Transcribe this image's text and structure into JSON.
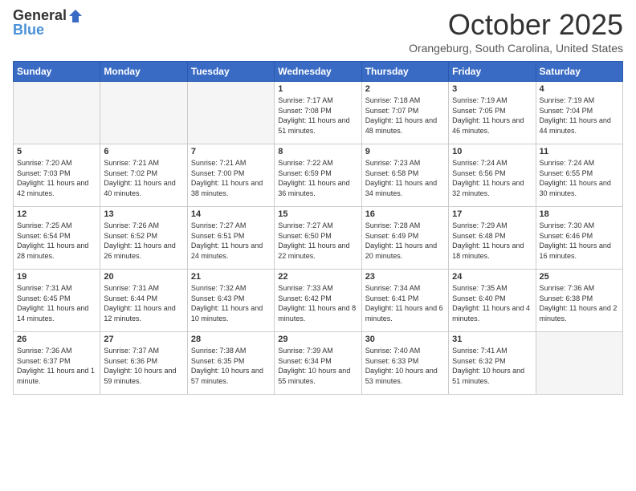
{
  "header": {
    "logo_general": "General",
    "logo_blue": "Blue",
    "month": "October 2025",
    "location": "Orangeburg, South Carolina, United States"
  },
  "weekdays": [
    "Sunday",
    "Monday",
    "Tuesday",
    "Wednesday",
    "Thursday",
    "Friday",
    "Saturday"
  ],
  "weeks": [
    [
      {
        "day": "",
        "sunrise": "",
        "sunset": "",
        "daylight": "",
        "empty": true
      },
      {
        "day": "",
        "sunrise": "",
        "sunset": "",
        "daylight": "",
        "empty": true
      },
      {
        "day": "",
        "sunrise": "",
        "sunset": "",
        "daylight": "",
        "empty": true
      },
      {
        "day": "1",
        "sunrise": "Sunrise: 7:17 AM",
        "sunset": "Sunset: 7:08 PM",
        "daylight": "Daylight: 11 hours and 51 minutes."
      },
      {
        "day": "2",
        "sunrise": "Sunrise: 7:18 AM",
        "sunset": "Sunset: 7:07 PM",
        "daylight": "Daylight: 11 hours and 48 minutes."
      },
      {
        "day": "3",
        "sunrise": "Sunrise: 7:19 AM",
        "sunset": "Sunset: 7:05 PM",
        "daylight": "Daylight: 11 hours and 46 minutes."
      },
      {
        "day": "4",
        "sunrise": "Sunrise: 7:19 AM",
        "sunset": "Sunset: 7:04 PM",
        "daylight": "Daylight: 11 hours and 44 minutes."
      }
    ],
    [
      {
        "day": "5",
        "sunrise": "Sunrise: 7:20 AM",
        "sunset": "Sunset: 7:03 PM",
        "daylight": "Daylight: 11 hours and 42 minutes."
      },
      {
        "day": "6",
        "sunrise": "Sunrise: 7:21 AM",
        "sunset": "Sunset: 7:02 PM",
        "daylight": "Daylight: 11 hours and 40 minutes."
      },
      {
        "day": "7",
        "sunrise": "Sunrise: 7:21 AM",
        "sunset": "Sunset: 7:00 PM",
        "daylight": "Daylight: 11 hours and 38 minutes."
      },
      {
        "day": "8",
        "sunrise": "Sunrise: 7:22 AM",
        "sunset": "Sunset: 6:59 PM",
        "daylight": "Daylight: 11 hours and 36 minutes."
      },
      {
        "day": "9",
        "sunrise": "Sunrise: 7:23 AM",
        "sunset": "Sunset: 6:58 PM",
        "daylight": "Daylight: 11 hours and 34 minutes."
      },
      {
        "day": "10",
        "sunrise": "Sunrise: 7:24 AM",
        "sunset": "Sunset: 6:56 PM",
        "daylight": "Daylight: 11 hours and 32 minutes."
      },
      {
        "day": "11",
        "sunrise": "Sunrise: 7:24 AM",
        "sunset": "Sunset: 6:55 PM",
        "daylight": "Daylight: 11 hours and 30 minutes."
      }
    ],
    [
      {
        "day": "12",
        "sunrise": "Sunrise: 7:25 AM",
        "sunset": "Sunset: 6:54 PM",
        "daylight": "Daylight: 11 hours and 28 minutes."
      },
      {
        "day": "13",
        "sunrise": "Sunrise: 7:26 AM",
        "sunset": "Sunset: 6:52 PM",
        "daylight": "Daylight: 11 hours and 26 minutes."
      },
      {
        "day": "14",
        "sunrise": "Sunrise: 7:27 AM",
        "sunset": "Sunset: 6:51 PM",
        "daylight": "Daylight: 11 hours and 24 minutes."
      },
      {
        "day": "15",
        "sunrise": "Sunrise: 7:27 AM",
        "sunset": "Sunset: 6:50 PM",
        "daylight": "Daylight: 11 hours and 22 minutes."
      },
      {
        "day": "16",
        "sunrise": "Sunrise: 7:28 AM",
        "sunset": "Sunset: 6:49 PM",
        "daylight": "Daylight: 11 hours and 20 minutes."
      },
      {
        "day": "17",
        "sunrise": "Sunrise: 7:29 AM",
        "sunset": "Sunset: 6:48 PM",
        "daylight": "Daylight: 11 hours and 18 minutes."
      },
      {
        "day": "18",
        "sunrise": "Sunrise: 7:30 AM",
        "sunset": "Sunset: 6:46 PM",
        "daylight": "Daylight: 11 hours and 16 minutes."
      }
    ],
    [
      {
        "day": "19",
        "sunrise": "Sunrise: 7:31 AM",
        "sunset": "Sunset: 6:45 PM",
        "daylight": "Daylight: 11 hours and 14 minutes."
      },
      {
        "day": "20",
        "sunrise": "Sunrise: 7:31 AM",
        "sunset": "Sunset: 6:44 PM",
        "daylight": "Daylight: 11 hours and 12 minutes."
      },
      {
        "day": "21",
        "sunrise": "Sunrise: 7:32 AM",
        "sunset": "Sunset: 6:43 PM",
        "daylight": "Daylight: 11 hours and 10 minutes."
      },
      {
        "day": "22",
        "sunrise": "Sunrise: 7:33 AM",
        "sunset": "Sunset: 6:42 PM",
        "daylight": "Daylight: 11 hours and 8 minutes."
      },
      {
        "day": "23",
        "sunrise": "Sunrise: 7:34 AM",
        "sunset": "Sunset: 6:41 PM",
        "daylight": "Daylight: 11 hours and 6 minutes."
      },
      {
        "day": "24",
        "sunrise": "Sunrise: 7:35 AM",
        "sunset": "Sunset: 6:40 PM",
        "daylight": "Daylight: 11 hours and 4 minutes."
      },
      {
        "day": "25",
        "sunrise": "Sunrise: 7:36 AM",
        "sunset": "Sunset: 6:38 PM",
        "daylight": "Daylight: 11 hours and 2 minutes."
      }
    ],
    [
      {
        "day": "26",
        "sunrise": "Sunrise: 7:36 AM",
        "sunset": "Sunset: 6:37 PM",
        "daylight": "Daylight: 11 hours and 1 minute."
      },
      {
        "day": "27",
        "sunrise": "Sunrise: 7:37 AM",
        "sunset": "Sunset: 6:36 PM",
        "daylight": "Daylight: 10 hours and 59 minutes."
      },
      {
        "day": "28",
        "sunrise": "Sunrise: 7:38 AM",
        "sunset": "Sunset: 6:35 PM",
        "daylight": "Daylight: 10 hours and 57 minutes."
      },
      {
        "day": "29",
        "sunrise": "Sunrise: 7:39 AM",
        "sunset": "Sunset: 6:34 PM",
        "daylight": "Daylight: 10 hours and 55 minutes."
      },
      {
        "day": "30",
        "sunrise": "Sunrise: 7:40 AM",
        "sunset": "Sunset: 6:33 PM",
        "daylight": "Daylight: 10 hours and 53 minutes."
      },
      {
        "day": "31",
        "sunrise": "Sunrise: 7:41 AM",
        "sunset": "Sunset: 6:32 PM",
        "daylight": "Daylight: 10 hours and 51 minutes."
      },
      {
        "day": "",
        "sunrise": "",
        "sunset": "",
        "daylight": "",
        "empty": true
      }
    ]
  ]
}
